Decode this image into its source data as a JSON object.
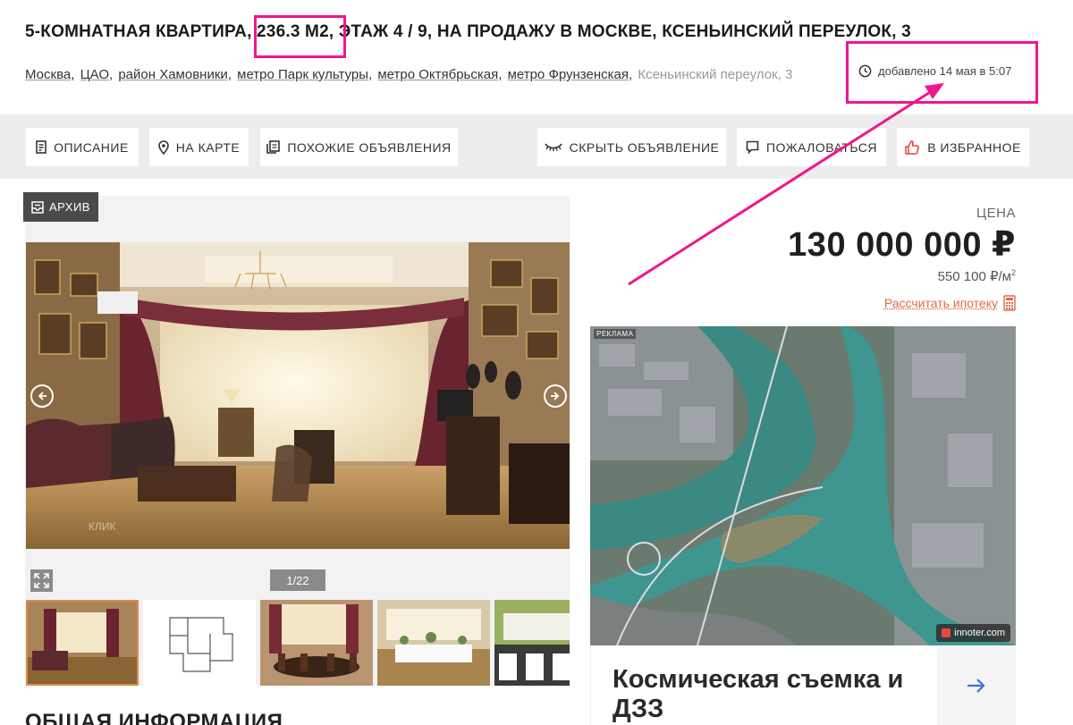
{
  "listing": {
    "title": "5-КОМНАТНАЯ КВАРТИРА, 236.3 М2, ЭТАЖ 4 / 9, НА ПРОДАЖУ В МОСКВЕ, КСЕНЬИНСКИЙ ПЕРЕУЛОК, 3",
    "address_links": [
      "Москва,",
      "ЦАО,",
      "район Хамовники,",
      "метро Парк культуры,",
      "метро Октябрьская,",
      "метро Фрунзенская,"
    ],
    "address_plain": "Ксеньинский переулок, 3",
    "added": "добавлено 14 мая в 5:07"
  },
  "toolbar": {
    "description": "ОПИСАНИЕ",
    "on_map": "НА КАРТЕ",
    "similar": "ПОХОЖИЕ ОБЪЯВЛЕНИЯ",
    "hide": "СКРЫТЬ ОБЪЯВЛЕНИЕ",
    "complain": "ПОЖАЛОВАТЬСЯ",
    "favorite": "В ИЗБРАННОЕ"
  },
  "gallery": {
    "archive": "АРХИВ",
    "counter": "1/22",
    "thumb_count": 5
  },
  "price": {
    "label": "ЦЕНА",
    "value": "130 000 000 ₽",
    "per_sqm": "550 100 ₽/м",
    "per_sqm_sup": "2",
    "mortgage": "Рассчитать ипотеку"
  },
  "ad": {
    "tag": "РЕКЛАМА",
    "brand": "innoter.com",
    "text": "Космическая съемка и ДЗЗ"
  },
  "section": {
    "title": "ОБЩАЯ ИНФОРМАЦИЯ"
  },
  "colors": {
    "highlight": "#f0168c",
    "accent": "#e06a4a",
    "toolbar_bg": "#ededed"
  }
}
